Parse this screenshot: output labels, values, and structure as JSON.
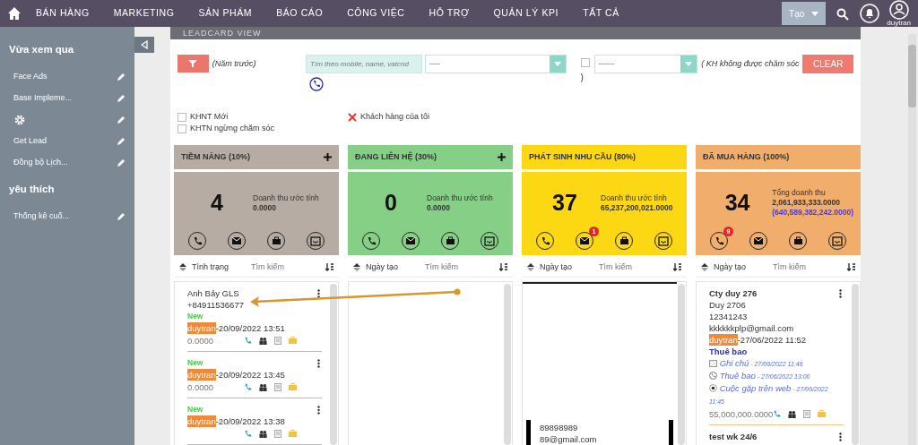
{
  "nav": {
    "items": [
      {
        "label": "BÁN HÀNG",
        "selected": false
      },
      {
        "label": "MARKETING",
        "selected": false
      },
      {
        "label": "SẢN PHẨM",
        "selected": false
      },
      {
        "label": "BÁO CÁO",
        "selected": false
      },
      {
        "label": "CÔNG VIỆC",
        "selected": false
      },
      {
        "label": "HỖ TRỢ",
        "selected": false
      },
      {
        "label": "QUẢN LÝ KPI",
        "selected": false
      },
      {
        "label": "TẤT CẢ",
        "selected": false
      }
    ],
    "create_button": "Tạo",
    "user": "duytran"
  },
  "sidebar": {
    "sections": [
      {
        "title": "Vừa xem qua",
        "items": [
          {
            "kind": "text",
            "label": "Face Ads"
          },
          {
            "kind": "text",
            "label": "Base Impleme..."
          },
          {
            "kind": "gear"
          },
          {
            "kind": "text",
            "label": "Get Lead"
          },
          {
            "kind": "text",
            "label": "Đồng bộ Lịch..."
          }
        ]
      },
      {
        "title": "yêu thích",
        "items": [
          {
            "kind": "text",
            "label": "Thống kê cuố..."
          }
        ]
      }
    ]
  },
  "panel_title": "LEADCARD VIEW",
  "filters": {
    "period": "(Năm trước)",
    "search_placeholder": "Tìm theo mobile, name, vatcod",
    "select_1": "----",
    "checkbox_checked": false,
    "paren": ")",
    "select_2": "------",
    "note": "( KH không được chăm sóc",
    "clear": "CLEAR"
  },
  "options": [
    {
      "label": "KHNT Mới",
      "checked": false
    },
    {
      "label": "KHTN ngừng chăm sóc",
      "checked": false
    },
    {
      "label": "Khách hàng của tôi",
      "checked": true
    }
  ],
  "columns": [
    {
      "title": "TIỀM NĂNG (10%)",
      "color": "#b7aca3",
      "add": true,
      "count": "4",
      "revenue_label": "Doanh thu ước tính",
      "revenue": "0.0000",
      "actions": [
        {
          "kind": "call"
        },
        {
          "kind": "email"
        },
        {
          "kind": "task"
        },
        {
          "kind": "inbox"
        }
      ],
      "sort": "Tình trạng",
      "search_placeholder": "Tìm kiếm",
      "cards": [
        {
          "kind": "lead",
          "lines": [
            "Anh Bảy GLS",
            "+84911536677"
          ],
          "status": "New",
          "user": "duytran",
          "date": "-20/09/2022 13:51",
          "amount": "0.0000"
        },
        {
          "kind": "lead",
          "status": "New",
          "user": "duytran",
          "date": "-20/09/2022 13:45",
          "amount": "0.0000"
        },
        {
          "kind": "lead",
          "status": "New",
          "user": "duytran",
          "date": "-20/09/2022 13:38"
        }
      ]
    },
    {
      "title": "ĐANG LIÊN HỆ (30%)",
      "color": "#86cf86",
      "add": true,
      "count": "0",
      "revenue_label": "Doanh thu ước tính",
      "revenue": "0.0000",
      "actions": [
        {
          "kind": "call"
        },
        {
          "kind": "email"
        },
        {
          "kind": "task"
        },
        {
          "kind": "inbox"
        }
      ],
      "sort": "Ngày tạo",
      "search_placeholder": "Tìm kiếm"
    },
    {
      "title": "PHÁT SINH NHU CẦU (80%)",
      "color": "#fbd714",
      "add": false,
      "count": "37",
      "revenue_label": "Doanh thu ước tính",
      "revenue": "65,237,200,021.0000",
      "actions": [
        {
          "kind": "call"
        },
        {
          "kind": "email",
          "badge": "1"
        },
        {
          "kind": "task"
        },
        {
          "kind": "inbox"
        }
      ],
      "sort": "Ngày tạo",
      "search_placeholder": "Tìm kiếm",
      "cards": [
        {
          "kind": "dragged",
          "lines": [
            "89898989",
            "89@gmail.com"
          ]
        }
      ]
    },
    {
      "title": "ĐÃ MUA HÀNG (100%)",
      "color": "#f1ad6c",
      "add": false,
      "count": "34",
      "revenue_label": "Tổng doanh thu",
      "revenue": "2,061,933,333.0000",
      "revenue_extra": "(640,589,382,242.0000)",
      "actions": [
        {
          "kind": "call",
          "badge": "9"
        },
        {
          "kind": "email"
        },
        {
          "kind": "task"
        },
        {
          "kind": "inbox"
        }
      ],
      "sort": "Ngày tạo",
      "search_placeholder": "Tìm kiếm",
      "cards": [
        {
          "kind": "customer",
          "company": "Cty duy 276",
          "lines": [
            "Duy 2706",
            "12341243",
            "kkkkkkplp@gmail.com"
          ],
          "user": "duytran",
          "date": "-27/06/2022 11:52",
          "product": "Thuê bao",
          "activities": [
            {
              "kind": "note",
              "title": "Ghi chú",
              "time": " - 27/06/2022 11:46"
            },
            {
              "kind": "call",
              "title": "Thuê bao",
              "time": " - 27/06/2022 13:00"
            },
            {
              "kind": "meeting",
              "title": "Cuộc gặp trên web",
              "time": " - 27/06/2022 11:45"
            }
          ],
          "amount": "55,000,000.0000"
        },
        {
          "kind": "customer",
          "company": "test wk 24/6"
        }
      ]
    }
  ]
}
